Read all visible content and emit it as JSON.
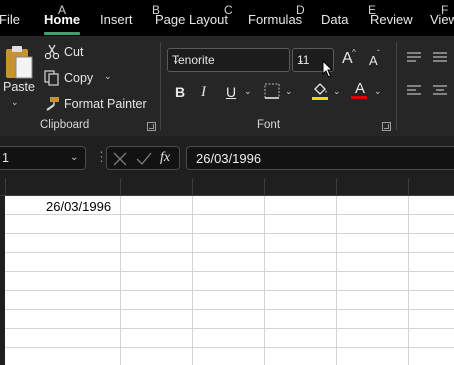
{
  "tabs": {
    "file": "File",
    "home": "Home",
    "insert": "Insert",
    "page_layout": "Page Layout",
    "formulas": "Formulas",
    "data": "Data",
    "review": "Review",
    "view": "View"
  },
  "clipboard": {
    "paste": "Paste",
    "cut": "Cut",
    "copy": "Copy",
    "format_painter": "Format Painter",
    "group_label": "Clipboard"
  },
  "font": {
    "name": "Tenorite",
    "size": "11",
    "group_label": "Font",
    "bold": "B",
    "italic": "I",
    "underline": "U",
    "grow": "A",
    "shrink": "A",
    "font_color_letter": "A",
    "highlight_color": "#ffd700",
    "font_color": "#e00000"
  },
  "formula_bar": {
    "name_box": "1",
    "fx": "fx",
    "value": "26/03/1996"
  },
  "columns": [
    "A",
    "B",
    "C",
    "D",
    "E",
    "F"
  ],
  "cells": {
    "A1": "26/03/1996"
  },
  "colors": {
    "accent": "#40a070"
  }
}
